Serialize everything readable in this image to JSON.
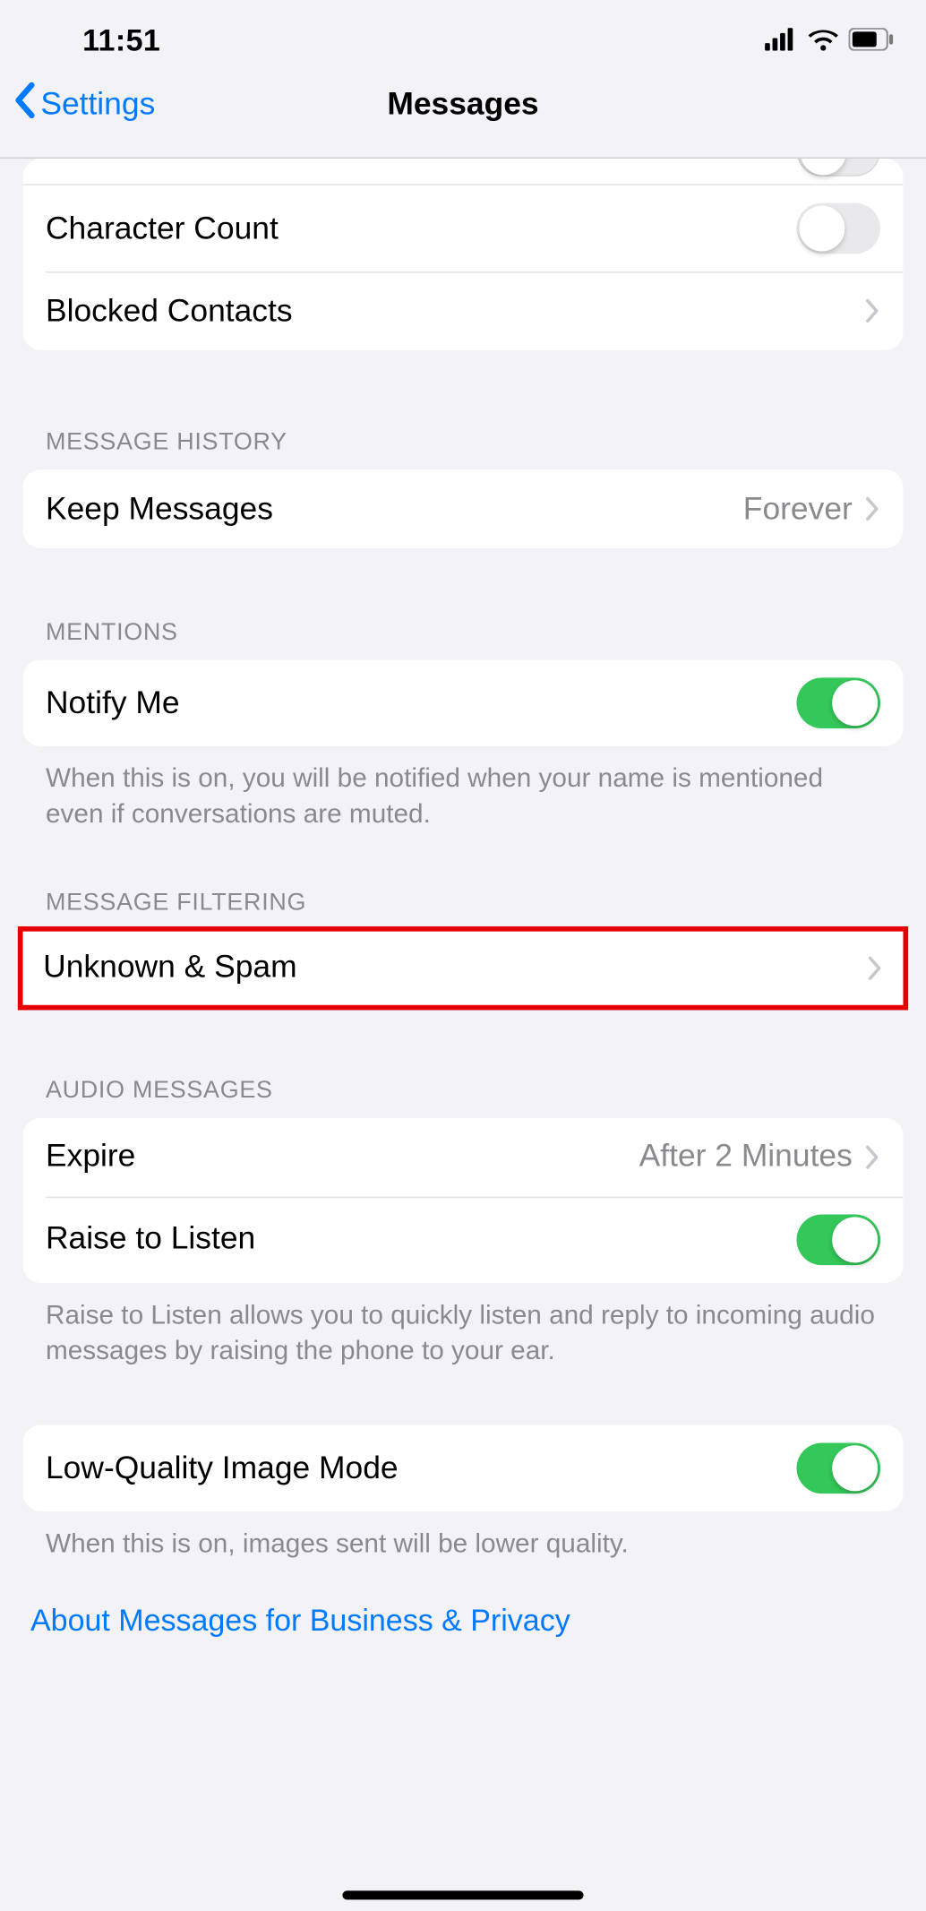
{
  "status": {
    "time": "11:51"
  },
  "nav": {
    "back_label": "Settings",
    "title": "Messages"
  },
  "sections": {
    "top": {
      "character_count": {
        "label": "Character Count",
        "on": false
      },
      "blocked_contacts": {
        "label": "Blocked Contacts"
      }
    },
    "history": {
      "header": "MESSAGE HISTORY",
      "keep": {
        "label": "Keep Messages",
        "value": "Forever"
      }
    },
    "mentions": {
      "header": "MENTIONS",
      "notify": {
        "label": "Notify Me",
        "on": true
      },
      "footer": "When this is on, you will be notified when your name is mentioned even if conversations are muted."
    },
    "filtering": {
      "header": "MESSAGE FILTERING",
      "unknown_spam": {
        "label": "Unknown & Spam"
      }
    },
    "audio": {
      "header": "AUDIO MESSAGES",
      "expire": {
        "label": "Expire",
        "value": "After 2 Minutes"
      },
      "raise": {
        "label": "Raise to Listen",
        "on": true
      },
      "footer": "Raise to Listen allows you to quickly listen and reply to incoming audio messages by raising the phone to your ear."
    },
    "low_quality": {
      "label": "Low-Quality Image Mode",
      "on": true,
      "footer": "When this is on, images sent will be lower quality."
    },
    "about_link": "About Messages for Business & Privacy"
  }
}
